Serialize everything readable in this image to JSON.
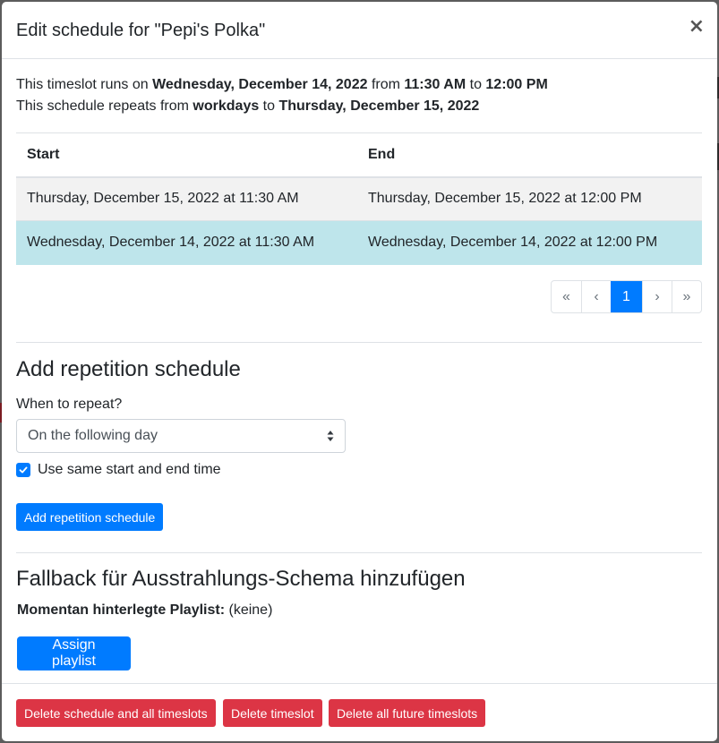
{
  "modal": {
    "title": "Edit schedule for \"Pepi's Polka\"",
    "close_glyph": "×"
  },
  "info": {
    "line1_prefix": "This timeslot runs on ",
    "line1_date": "Wednesday, December 14, 2022",
    "line1_from": " from ",
    "line1_start": "11:30 AM",
    "line1_to": " to ",
    "line1_end": "12:00 PM",
    "line2_prefix": "This schedule repeats from ",
    "line2_rule": "workdays",
    "line2_to": " to ",
    "line2_until": "Thursday, December 15, 2022"
  },
  "timeslots": {
    "headers": [
      "Start",
      "End"
    ],
    "rows": [
      {
        "start": "Thursday, December 15, 2022 at 11:30 AM",
        "end": "Thursday, December 15, 2022 at 12:00 PM"
      },
      {
        "start": "Wednesday, December 14, 2022 at 11:30 AM",
        "end": "Wednesday, December 14, 2022 at 12:00 PM"
      }
    ]
  },
  "pagination": {
    "first": "«",
    "prev": "‹",
    "current": "1",
    "next": "›",
    "last": "»"
  },
  "repetition": {
    "title": "Add repetition schedule",
    "when_label": "When to repeat?",
    "selected_option": "On the following day",
    "same_time_label": "Use same start and end time",
    "same_time_checked": true,
    "add_button": "Add repetition schedule"
  },
  "fallback": {
    "title": "Fallback für Ausstrahlungs-Schema hinzufügen",
    "playlist_label": "Momentan hinterlegte Playlist:",
    "playlist_value": " (keine)",
    "assign_button": "Assign playlist"
  },
  "footer": {
    "delete_schedule": "Delete schedule and all timeslots",
    "delete_timeslot": "Delete timeslot",
    "delete_future": "Delete all future timeslots"
  },
  "colors": {
    "primary": "#007bff",
    "danger": "#dc3545",
    "active_row": "#bee5eb",
    "striped_row": "#f2f2f2"
  }
}
